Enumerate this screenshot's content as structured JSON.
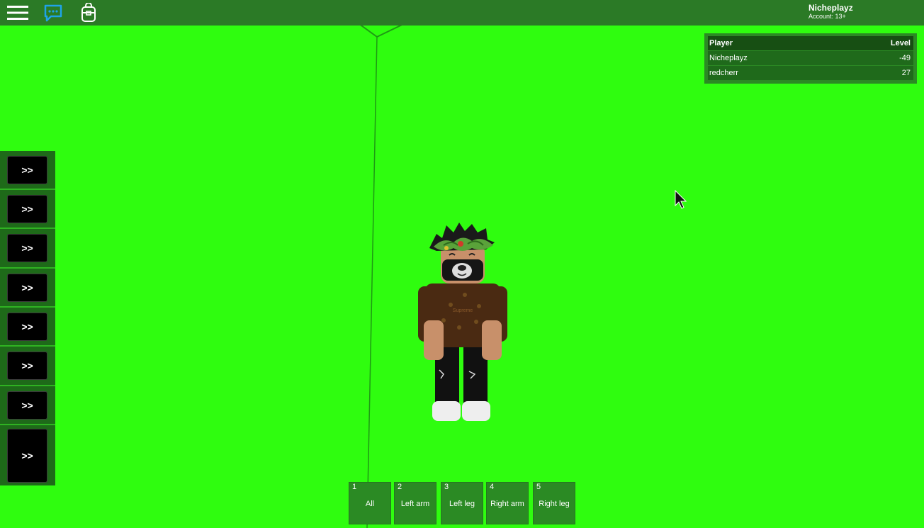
{
  "colors": {
    "background": "#2ffd0f",
    "topbar": "#2b7a26",
    "panel": "#1e6a19",
    "accent_chat": "#1fa3e8"
  },
  "topbar": {
    "icons": [
      "menu-icon",
      "chat-icon",
      "backpack-icon"
    ],
    "account_name": "Nicheplayz",
    "account_age": "Account: 13+"
  },
  "leaderboard": {
    "col_player": "Player",
    "col_level": "Level",
    "rows": [
      {
        "player": "Nicheplayz",
        "level": "-49"
      },
      {
        "player": "redcherr",
        "level": "27"
      }
    ]
  },
  "side_panel": {
    "buttons": [
      ">>",
      ">>",
      ">>",
      ">>",
      ">>",
      ">>",
      ">>",
      ">>"
    ]
  },
  "hotbar": [
    {
      "num": "1",
      "label": "All"
    },
    {
      "num": "2",
      "label": "Left arm"
    },
    {
      "num": "3",
      "label": "Left leg"
    },
    {
      "num": "4",
      "label": "Right arm"
    },
    {
      "num": "5",
      "label": "Right leg"
    }
  ],
  "avatar": {
    "shirt_text": "Supreme"
  }
}
